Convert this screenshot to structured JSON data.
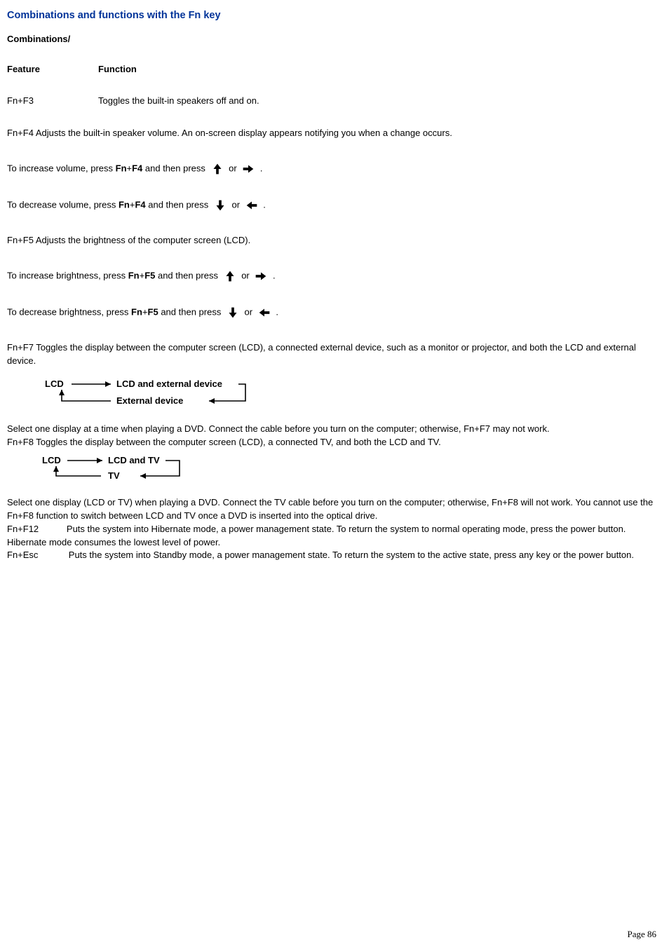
{
  "title": "Combinations and functions with the Fn key",
  "header_combinations": "Combinations/",
  "header_feature": "Feature",
  "header_function": "Function",
  "rows": {
    "r0": {
      "feature": "Fn+F3",
      "function": "Toggles the built-in speakers off and on."
    }
  },
  "p_fnf4": "Fn+F4  Adjusts the built-in speaker volume. An on-screen display appears notifying you when a change occurs.",
  "vol_inc_a": "To increase volume, press ",
  "vol_inc_b": " and then press ",
  "vol_dec_a": "To decrease volume, press ",
  "vol_dec_b": " and then press ",
  "fn_f4": "Fn",
  "plus": "+",
  "f4": "F4",
  "f5": "F5",
  "or": " or ",
  "dot": " .",
  "p_fnf5": "Fn+F5  Adjusts the brightness of the computer screen (LCD).",
  "bri_inc_a": "To increase brightness, press ",
  "bri_inc_b": " and then press ",
  "bri_dec_a": "To decrease brightness, press ",
  "bri_dec_b": " and then press ",
  "p_fnf7": "Fn+F7  Toggles the display between the computer screen (LCD), a connected external device, such as a monitor or projector, and both the LCD and external device.",
  "diagram1": {
    "lcd": "LCD",
    "both": "LCD and external device",
    "ext": "External device"
  },
  "p_sel1": "Select one display at a time when playing a DVD. Connect the cable before you turn on the computer; otherwise, Fn+F7 may not work.",
  "p_fnf8": "Fn+F8  Toggles the display between the computer screen (LCD), a connected TV, and both the LCD and TV.",
  "diagram2": {
    "lcd": "LCD",
    "both": "LCD and TV",
    "tv": "TV"
  },
  "p_sel2": "Select one display (LCD or TV) when playing a DVD. Connect the TV cable before you turn on the computer; otherwise, Fn+F8 will not work. You cannot use the Fn+F8 function to switch between LCD and TV once a DVD is inserted into the optical drive.",
  "p_fnf12": "Fn+F12           Puts the system into Hibernate mode, a power management state. To return the system to normal operating mode, press the power button. Hibernate mode consumes the lowest level of power.",
  "p_fnesc": "Fn+Esc            Puts the system into Standby mode, a power management state. To return the system to the active state, press any key or the power button.",
  "page_label": "Page 86"
}
